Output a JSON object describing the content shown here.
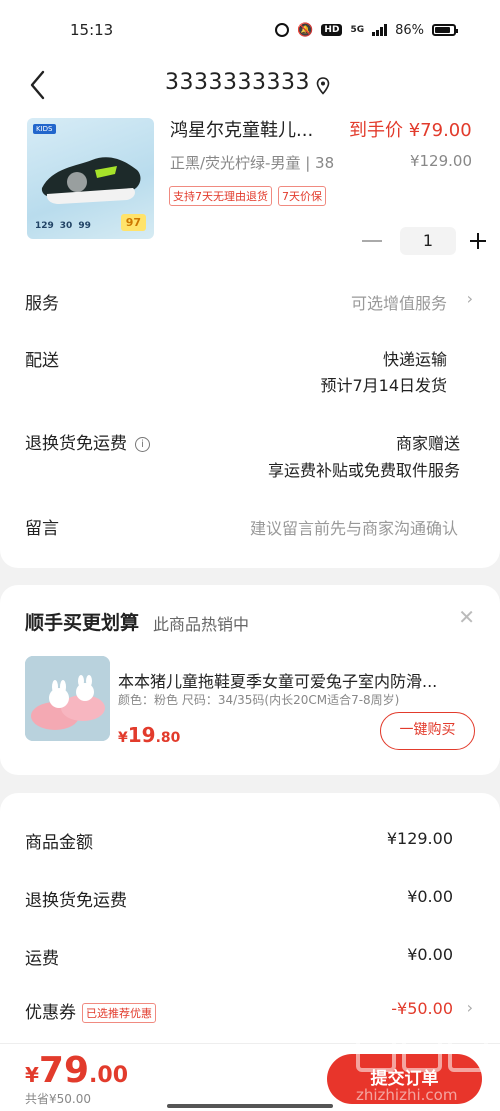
{
  "status_bar": {
    "time": "15:13",
    "network": "5G",
    "battery": "86%"
  },
  "header": {
    "title": "3333333333",
    "back_icon": "chevron-left-icon",
    "location_icon": "location-pin-icon"
  },
  "product": {
    "name": "鸿星尔克童鞋儿...",
    "final_price": "到手价 ¥79.00",
    "variant": "正黑/荧光柠绿-男童 | 38",
    "original_price": "¥129.00",
    "tags": [
      "支持7天无理由退货",
      "7天价保"
    ],
    "quantity": "1",
    "image_badge": "97",
    "image_kids": "KIDS",
    "image_stats": [
      "129",
      "30",
      "99"
    ]
  },
  "rows": {
    "service": {
      "label": "服务",
      "value": "可选增值服务"
    },
    "delivery": {
      "label": "配送",
      "value_line1": "快递运输",
      "value_line2": "预计7月14日发货"
    },
    "return": {
      "label": "退换货免运费",
      "value_line1": "商家赠送",
      "value_line2": "享运费补贴或免费取件服务"
    },
    "message": {
      "label": "留言",
      "placeholder": "建议留言前先与商家沟通确认"
    }
  },
  "recommend": {
    "title": "顺手买更划算",
    "subtitle": "此商品热销中",
    "product_name": "本本猪儿童拖鞋夏季女童可爱兔子室内防滑...",
    "attrs": "颜色：粉色   尺码：34/35码(内长20CM适合7-8周岁)",
    "price_symbol": "¥",
    "price_int": "19",
    "price_dec": ".80",
    "buy_label": "一键购买"
  },
  "summary": {
    "items": [
      {
        "label": "商品金额",
        "value": "¥129.00"
      },
      {
        "label": "退换货免运费",
        "value": "¥0.00"
      },
      {
        "label": "运费",
        "value": "¥0.00"
      }
    ],
    "coupon": {
      "label": "优惠券",
      "tag": "已选推荐优惠",
      "value": "-¥50.00"
    }
  },
  "bottom": {
    "price_symbol": "¥",
    "price_int": "79",
    "price_dec": ".00",
    "discount_text": "共省¥50.00",
    "submit_label": "提交订单"
  },
  "watermark_text": "zhizhizhi.com",
  "colors": {
    "accent": "#e23b2c",
    "submit": "#e8352b",
    "muted": "#888888"
  }
}
